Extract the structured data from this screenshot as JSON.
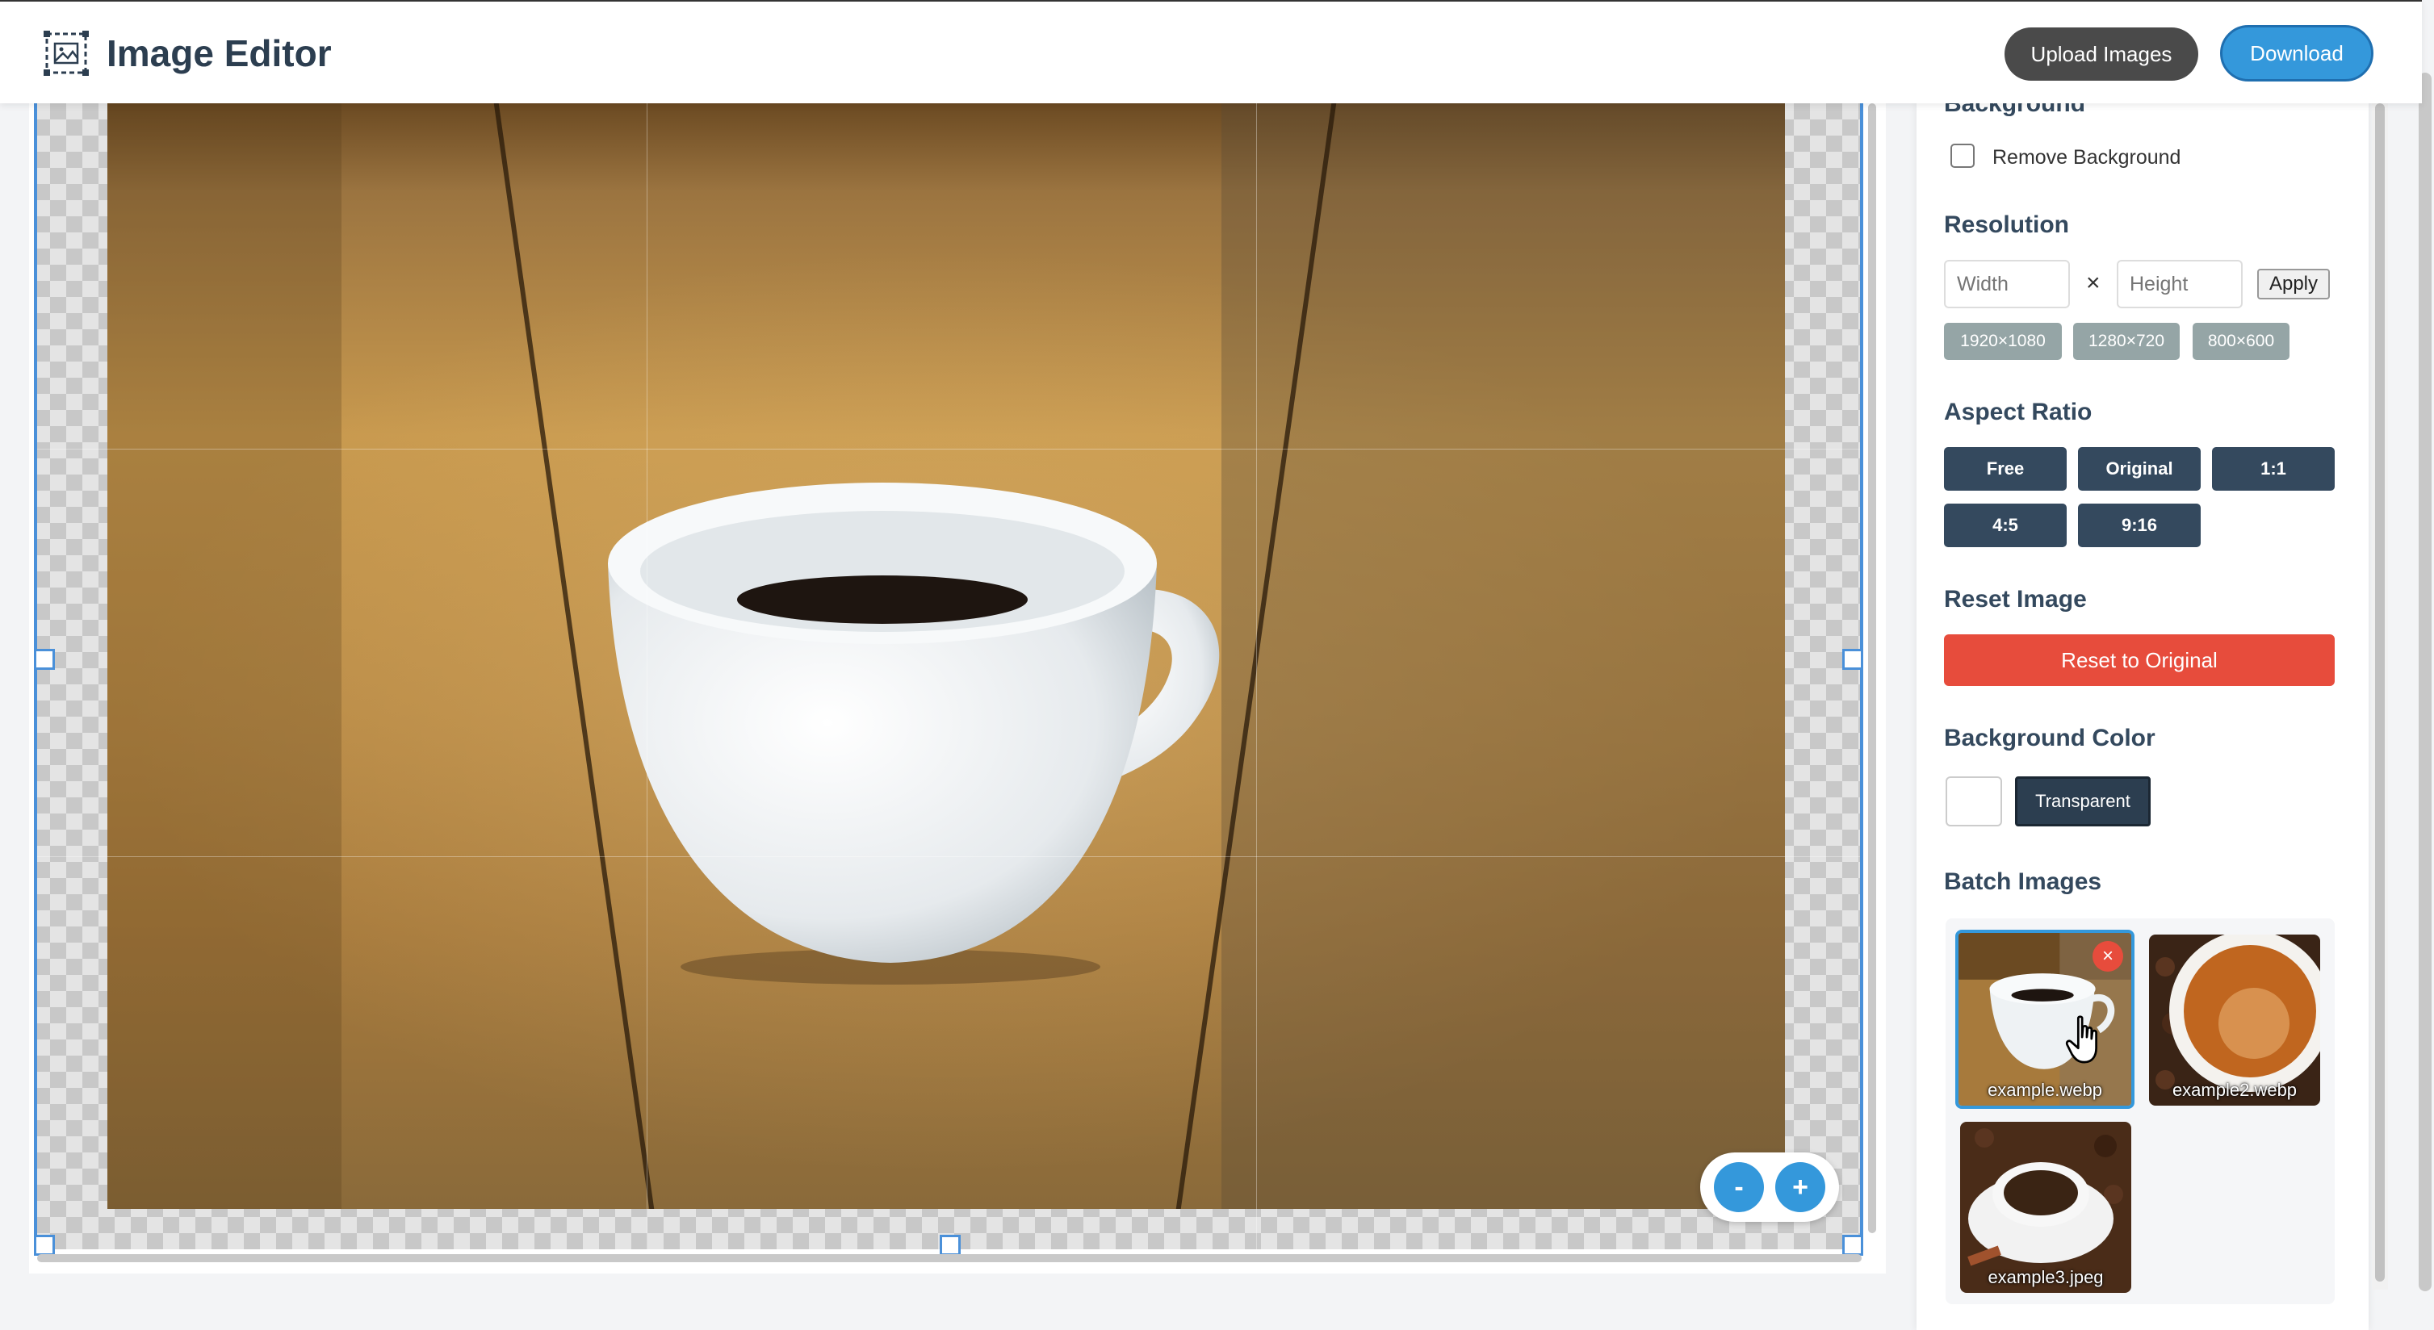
{
  "header": {
    "title": "Image Editor",
    "upload_label": "Upload Images",
    "download_label": "Download",
    "logo_icon": "image-frame-icon"
  },
  "editor": {
    "zoom_out_label": "-",
    "zoom_in_label": "+"
  },
  "sidebar": {
    "background": {
      "title": "Background",
      "remove_label": "Remove Background",
      "remove_checked": false
    },
    "resolution": {
      "title": "Resolution",
      "width_placeholder": "Width",
      "height_placeholder": "Height",
      "times": "×",
      "apply_label": "Apply",
      "presets": [
        "1920×1080",
        "1280×720",
        "800×600"
      ]
    },
    "aspect_ratio": {
      "title": "Aspect Ratio",
      "options": [
        "Free",
        "Original",
        "1:1",
        "4:5",
        "9:16"
      ]
    },
    "reset": {
      "title": "Reset Image",
      "button_label": "Reset to Original"
    },
    "background_color": {
      "title": "Background Color",
      "swatch_color": "#ffffff",
      "transparent_label": "Transparent"
    },
    "batch": {
      "title": "Batch Images",
      "close_label": "×",
      "items": [
        {
          "name": "example.webp",
          "active": true
        },
        {
          "name": "example2.webp",
          "active": false
        },
        {
          "name": "example3.jpeg",
          "active": false
        }
      ]
    }
  },
  "colors": {
    "accent": "#3498db",
    "danger": "#e74c3c",
    "dark": "#34495e",
    "preset": "#95a5a6"
  }
}
